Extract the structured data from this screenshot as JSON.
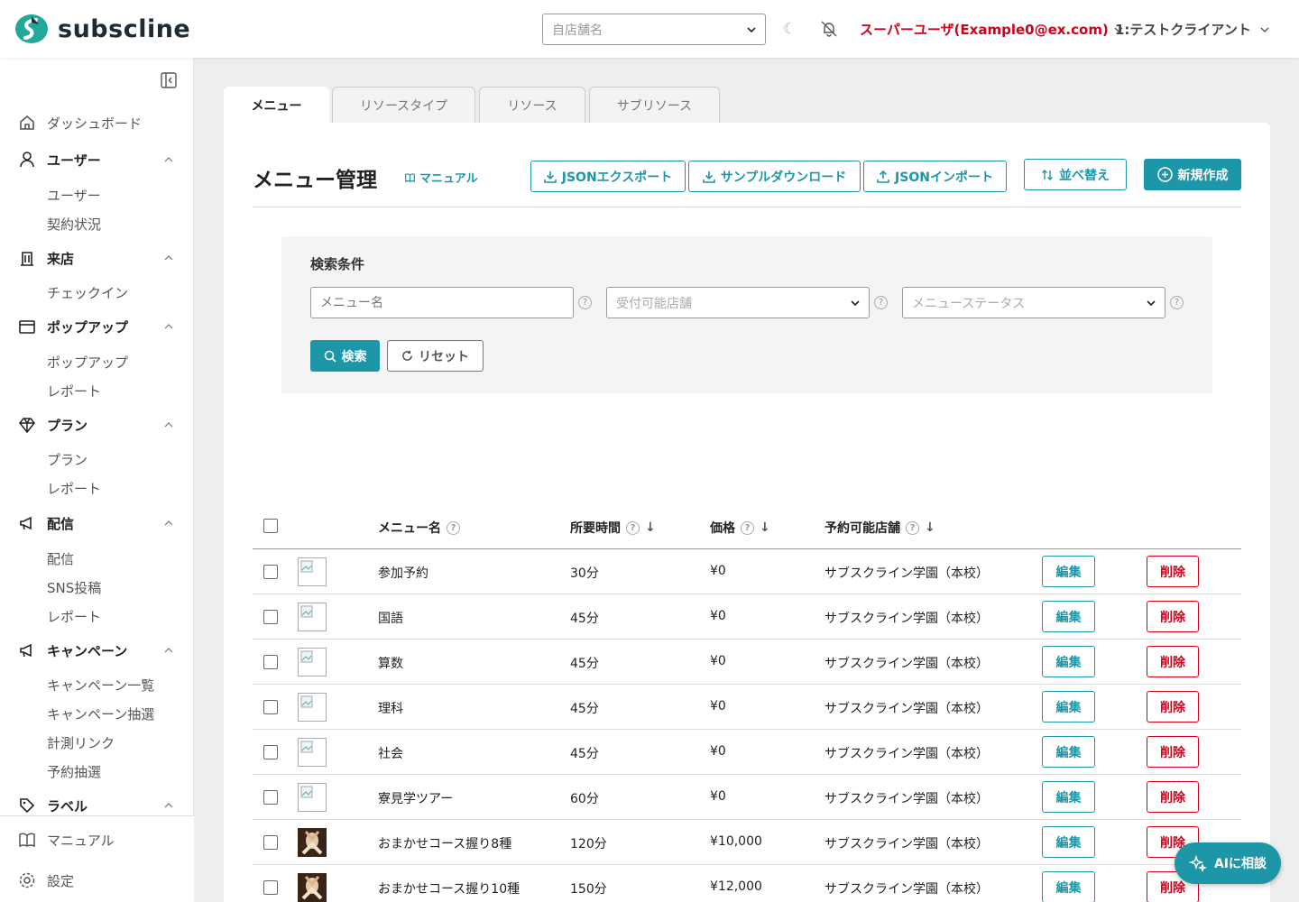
{
  "header": {
    "logo_text": "subscline",
    "store_placeholder": "自店舗名",
    "moon_glyph": "☾",
    "user_label": "スーパーユーザ(Example0@ex.com)",
    "client_label": "1:テストクライアント"
  },
  "sidebar": {
    "groups": [
      {
        "label": "ダッシュボード",
        "icon": "home-icon"
      },
      {
        "label": "ユーザー",
        "icon": "user-icon",
        "subs": [
          "ユーザー",
          "契約状況"
        ]
      },
      {
        "label": "来店",
        "icon": "building-icon",
        "subs": [
          "チェックイン"
        ]
      },
      {
        "label": "ポップアップ",
        "icon": "window-icon",
        "subs": [
          "ポップアップ",
          "レポート"
        ]
      },
      {
        "label": "プラン",
        "icon": "diamond-icon",
        "subs": [
          "プラン",
          "レポート"
        ]
      },
      {
        "label": "配信",
        "icon": "megaphone-icon",
        "subs": [
          "配信",
          "SNS投稿",
          "レポート"
        ]
      },
      {
        "label": "キャンペーン",
        "icon": "megaphone-icon",
        "subs": [
          "キャンペーン一覧",
          "キャンペーン抽選",
          "計測リンク",
          "予約抽選"
        ]
      },
      {
        "label": "ラベル",
        "icon": "tag-icon"
      }
    ],
    "bottom": {
      "manual": "マニュアル",
      "settings": "設定"
    }
  },
  "tabs": [
    "メニュー",
    "リソースタイプ",
    "リソース",
    "サブリソース"
  ],
  "page": {
    "title": "メニュー管理",
    "manual_link": "マニュアル",
    "json_export": "JSONエクスポート",
    "sample_download": "サンプルダウンロード",
    "json_import": "JSONインポート",
    "sort": "並べ替え",
    "create": "新規作成"
  },
  "search": {
    "title": "検索条件",
    "menu_name_placeholder": "メニュー名",
    "store_placeholder": "受付可能店舗",
    "status_placeholder": "メニューステータス",
    "search_btn": "検索",
    "reset_btn": "リセット",
    "help_glyph": "?"
  },
  "table": {
    "headers": {
      "name": "メニュー名",
      "duration": "所要時間",
      "price": "価格",
      "store": "予約可能店舗"
    },
    "sort_glyph": "↓",
    "edit_label": "編集",
    "delete_label": "削除",
    "rows": [
      {
        "name": "参加予約",
        "duration": "30分",
        "price": "¥0",
        "store": "サブスクライン学園（本校）",
        "photo": false
      },
      {
        "name": "国語",
        "duration": "45分",
        "price": "¥0",
        "store": "サブスクライン学園（本校）",
        "photo": false
      },
      {
        "name": "算数",
        "duration": "45分",
        "price": "¥0",
        "store": "サブスクライン学園（本校）",
        "photo": false
      },
      {
        "name": "理科",
        "duration": "45分",
        "price": "¥0",
        "store": "サブスクライン学園（本校）",
        "photo": false
      },
      {
        "name": "社会",
        "duration": "45分",
        "price": "¥0",
        "store": "サブスクライン学園（本校）",
        "photo": false
      },
      {
        "name": "寮見学ツアー",
        "duration": "60分",
        "price": "¥0",
        "store": "サブスクライン学園（本校）",
        "photo": false
      },
      {
        "name": "おまかせコース握り8種",
        "duration": "120分",
        "price": "¥10,000",
        "store": "サブスクライン学園（本校）",
        "photo": true
      },
      {
        "name": "おまかせコース握り10種",
        "duration": "150分",
        "price": "¥12,000",
        "store": "サブスクライン学園（本校）",
        "photo": true
      }
    ]
  },
  "ai_button": "AIに相談",
  "colors": {
    "accent": "#1d96a8",
    "danger": "#d0021b"
  }
}
